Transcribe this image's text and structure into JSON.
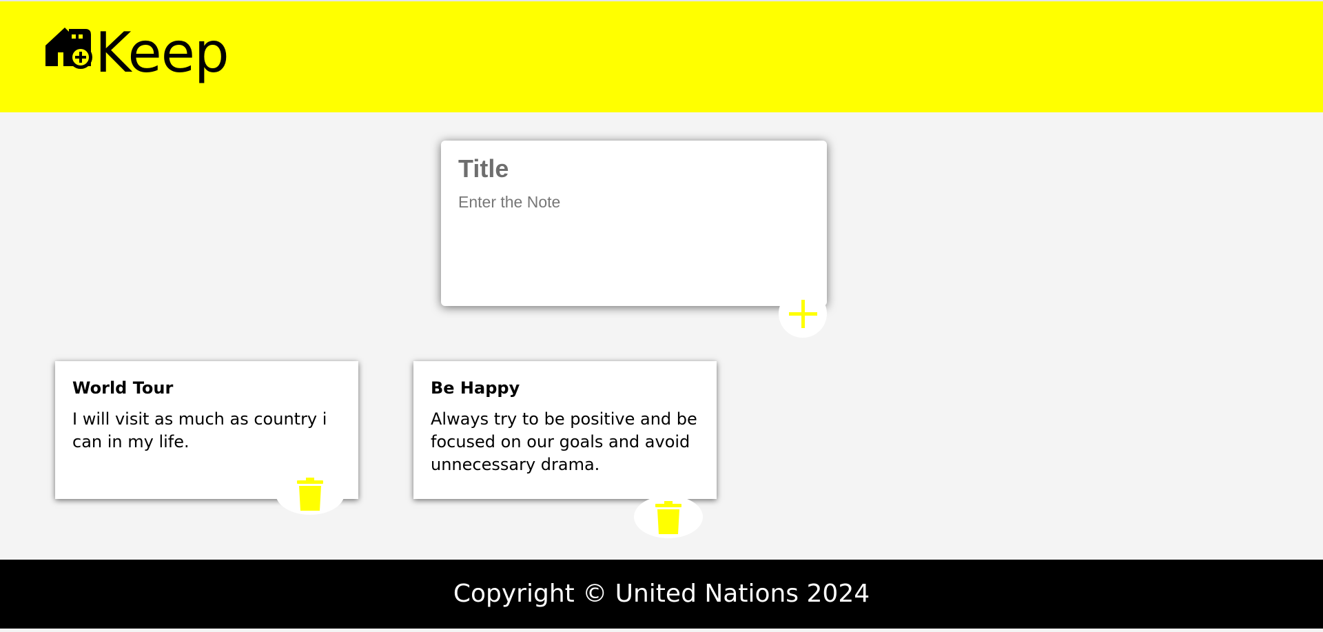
{
  "header": {
    "app_name": "Keep",
    "logo_icon": "house-plus-icon",
    "background_color": "#ffff00"
  },
  "create_note": {
    "title_placeholder": "Title",
    "content_placeholder": "Enter the Note",
    "add_icon": "plus-icon",
    "accent_color": "#ffff00"
  },
  "notes": [
    {
      "title": "World Tour",
      "content": "I will visit as much as country i can in my life.",
      "delete_icon": "trash-icon"
    },
    {
      "title": "Be Happy",
      "content": "Always try to be positive and be focused on our goals and avoid unnecessary drama.",
      "delete_icon": "trash-icon"
    }
  ],
  "footer": {
    "copyright": "Copyright © United Nations 2024"
  }
}
